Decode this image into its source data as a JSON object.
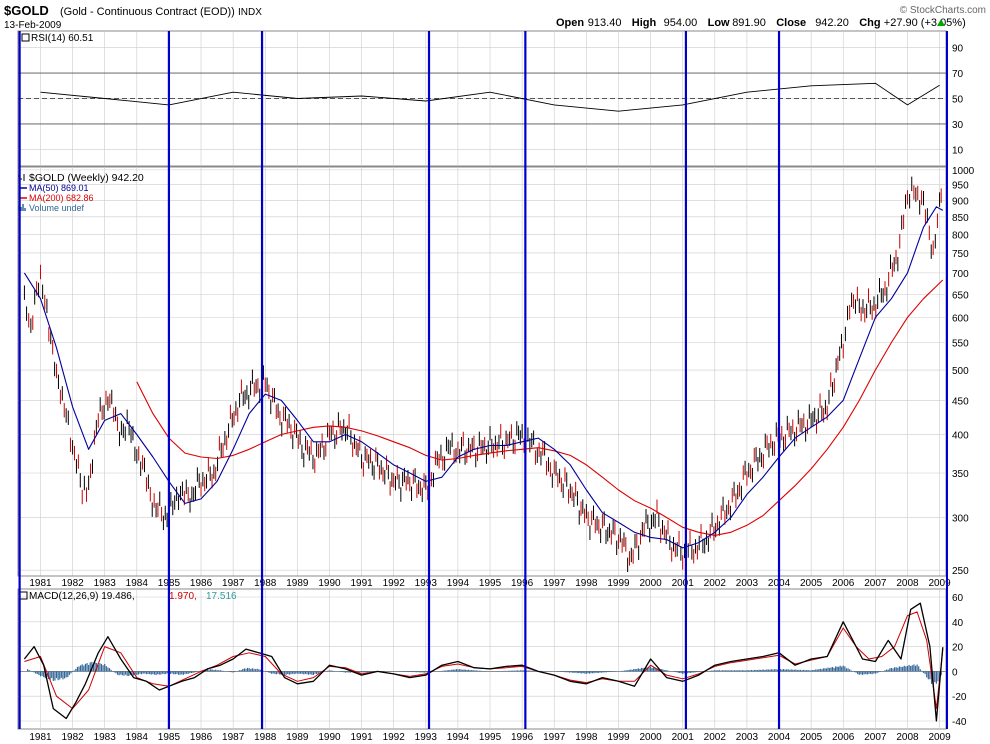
{
  "header": {
    "symbol": "$GOLD",
    "description": "(Gold - Continuous Contract (EOD))",
    "exchange": "INDX",
    "date": "13-Feb-2009",
    "watermark": "© StockCharts.com",
    "ohlc": [
      {
        "label": "Open",
        "value": "913.40"
      },
      {
        "label": "High",
        "value": "954.00"
      },
      {
        "label": "Low",
        "value": "891.90"
      },
      {
        "label": "Close",
        "value": "942.20"
      },
      {
        "label": "Chg",
        "value": "+27.90 (+3.05%)"
      }
    ],
    "chg_arrow": "up-arrow-icon"
  },
  "colors": {
    "price": "#000000",
    "price_down": "#cc0000",
    "ma50": "#000099",
    "ma200": "#dd0000",
    "volume": "#336699",
    "vlines": "#0000cc",
    "grid": "#cccccc",
    "macd": "#000000",
    "signal": "#cc0000",
    "histogram": "#336699",
    "teal": "#339999"
  },
  "chart_data": [
    {
      "type": "line",
      "panel": "RSI",
      "legend": "RSI(14) 60.51",
      "ylim": [
        0,
        100
      ],
      "yticks": [
        "90",
        "70",
        "50",
        "30",
        "10"
      ],
      "reference_lines": [
        30,
        50,
        70
      ],
      "x": [
        "1981",
        "1983",
        "1985",
        "1987",
        "1989",
        "1991",
        "1993",
        "1995",
        "1997",
        "1999",
        "2001",
        "2003",
        "2005",
        "2007",
        "2008",
        "2009"
      ],
      "y": [
        55,
        50,
        45,
        55,
        50,
        52,
        48,
        55,
        45,
        40,
        45,
        55,
        60,
        62,
        45,
        60.51
      ]
    },
    {
      "type": "line",
      "panel": "Price",
      "scale": "log",
      "ylim": [
        250,
        1000
      ],
      "yticks": [
        "1000",
        "950",
        "900",
        "850",
        "800",
        "750",
        "700",
        "650",
        "600",
        "550",
        "500",
        "450",
        "400",
        "350",
        "300",
        "250"
      ],
      "legend": [
        {
          "text": "$GOLD (Weekly) 942.20",
          "color": "#000000",
          "kind": "bar"
        },
        {
          "text": "MA(50) 869.01",
          "color": "#000099",
          "kind": "line"
        },
        {
          "text": "MA(200) 682.86",
          "color": "#dd0000",
          "kind": "line"
        },
        {
          "text": "Volume undef",
          "color": "#336699",
          "kind": "volume"
        }
      ],
      "xticks": [
        "1981",
        "1982",
        "1983",
        "1984",
        "1985",
        "1986",
        "1987",
        "1988",
        "1989",
        "1990",
        "1991",
        "1992",
        "1993",
        "1994",
        "1995",
        "1996",
        "1997",
        "1998",
        "1999",
        "2000",
        "2001",
        "2002",
        "2003",
        "2004",
        "2005",
        "2006",
        "2007",
        "2008",
        "2009"
      ],
      "series": [
        {
          "name": "$GOLD (Weekly)",
          "x": [
            1980.5,
            1980.7,
            1981.0,
            1981.2,
            1981.5,
            1981.8,
            1982.0,
            1982.3,
            1982.5,
            1982.8,
            1983.1,
            1983.4,
            1983.7,
            1984.0,
            1984.3,
            1984.6,
            1985.0,
            1985.3,
            1985.6,
            1986.0,
            1986.4,
            1986.8,
            1987.2,
            1987.6,
            1988.0,
            1988.4,
            1988.8,
            1989.2,
            1989.6,
            1990.0,
            1990.5,
            1991.0,
            1991.5,
            1992.0,
            1992.5,
            1993.0,
            1993.3,
            1993.7,
            1994.0,
            1994.5,
            1995.0,
            1995.5,
            1996.0,
            1996.3,
            1996.7,
            1997.0,
            1997.5,
            1998.0,
            1998.5,
            1999.0,
            1999.4,
            1999.8,
            2000.2,
            2000.6,
            2001.0,
            2001.4,
            2001.8,
            2002.2,
            2002.6,
            2003.0,
            2003.4,
            2003.8,
            2004.2,
            2004.6,
            2005.0,
            2005.5,
            2006.0,
            2006.2,
            2006.5,
            2006.9,
            2007.3,
            2007.7,
            2008.0,
            2008.2,
            2008.5,
            2008.8,
            2009.0,
            2009.1
          ],
          "y": [
            650,
            580,
            690,
            620,
            480,
            440,
            380,
            330,
            340,
            420,
            460,
            410,
            410,
            380,
            340,
            310,
            300,
            330,
            320,
            340,
            350,
            400,
            450,
            470,
            480,
            430,
            410,
            380,
            370,
            400,
            410,
            370,
            360,
            340,
            340,
            330,
            360,
            380,
            380,
            380,
            385,
            390,
            400,
            385,
            370,
            350,
            330,
            300,
            290,
            280,
            260,
            290,
            300,
            275,
            265,
            270,
            280,
            300,
            320,
            350,
            370,
            390,
            400,
            410,
            420,
            440,
            550,
            640,
            620,
            620,
            660,
            750,
            900,
            950,
            880,
            760,
            900,
            942
          ]
        },
        {
          "name": "MA(50)",
          "x": [
            1980.5,
            1981.0,
            1981.5,
            1982.0,
            1982.5,
            1983.0,
            1983.5,
            1984.0,
            1984.5,
            1985.0,
            1985.5,
            1986.0,
            1986.5,
            1987.0,
            1987.5,
            1988.0,
            1988.5,
            1989.0,
            1989.5,
            1990.0,
            1990.5,
            1991.0,
            1991.5,
            1992.0,
            1992.5,
            1993.0,
            1993.5,
            1994.0,
            1994.5,
            1995.0,
            1995.5,
            1996.0,
            1996.5,
            1997.0,
            1997.5,
            1998.0,
            1998.5,
            1999.0,
            1999.5,
            2000.0,
            2000.5,
            2001.0,
            2001.5,
            2002.0,
            2002.5,
            2003.0,
            2003.5,
            2004.0,
            2004.5,
            2005.0,
            2005.5,
            2006.0,
            2006.5,
            2007.0,
            2007.5,
            2008.0,
            2008.5,
            2008.9,
            2009.1
          ],
          "y": [
            700,
            640,
            540,
            440,
            380,
            420,
            430,
            400,
            370,
            340,
            315,
            320,
            340,
            380,
            430,
            460,
            450,
            420,
            390,
            390,
            400,
            390,
            375,
            360,
            350,
            340,
            345,
            370,
            380,
            385,
            385,
            390,
            395,
            380,
            360,
            330,
            305,
            295,
            285,
            280,
            278,
            270,
            275,
            285,
            300,
            325,
            345,
            370,
            395,
            410,
            425,
            450,
            520,
            600,
            640,
            700,
            820,
            880,
            869
          ]
        },
        {
          "name": "MA(200)",
          "x": [
            1984.0,
            1984.5,
            1985.0,
            1985.5,
            1986.0,
            1986.5,
            1987.0,
            1987.5,
            1988.0,
            1988.5,
            1989.0,
            1989.5,
            1990.0,
            1990.5,
            1991.0,
            1991.5,
            1992.0,
            1992.5,
            1993.0,
            1993.5,
            1994.0,
            1994.5,
            1995.0,
            1995.5,
            1996.0,
            1996.5,
            1997.0,
            1997.5,
            1998.0,
            1998.5,
            1999.0,
            1999.5,
            2000.0,
            2000.5,
            2001.0,
            2001.5,
            2002.0,
            2002.5,
            2003.0,
            2003.5,
            2004.0,
            2004.5,
            2005.0,
            2005.5,
            2006.0,
            2006.5,
            2007.0,
            2007.5,
            2008.0,
            2008.5,
            2009.1
          ],
          "y": [
            480,
            430,
            395,
            375,
            370,
            368,
            372,
            380,
            390,
            400,
            405,
            410,
            412,
            410,
            405,
            398,
            390,
            382,
            372,
            366,
            368,
            372,
            375,
            378,
            380,
            382,
            378,
            372,
            360,
            345,
            330,
            318,
            310,
            300,
            290,
            285,
            282,
            285,
            292,
            302,
            318,
            335,
            355,
            380,
            410,
            450,
            500,
            550,
            600,
            640,
            683
          ]
        }
      ]
    },
    {
      "type": "line",
      "panel": "MACD",
      "legend": {
        "label": "MACD(12,26,9)",
        "v1": "19.486",
        "v2": "1.970",
        "v3": "17.516"
      },
      "ylim": [
        -40,
        60
      ],
      "yticks": [
        "60",
        "40",
        "20",
        "0",
        "-20",
        "-40"
      ],
      "xticks": [
        "1981",
        "1982",
        "1983",
        "1984",
        "1985",
        "1986",
        "1987",
        "1988",
        "1989",
        "1990",
        "1991",
        "1992",
        "1993",
        "1994",
        "1995",
        "1996",
        "1997",
        "1998",
        "1999",
        "2000",
        "2001",
        "2002",
        "2003",
        "2004",
        "2005",
        "2006",
        "2007",
        "2008",
        "2009"
      ],
      "series": [
        {
          "name": "MACD",
          "x": [
            1980.5,
            1980.8,
            1981.1,
            1981.4,
            1981.8,
            1982.1,
            1982.4,
            1982.8,
            1983.1,
            1983.5,
            1983.9,
            1984.3,
            1984.7,
            1985.0,
            1985.4,
            1985.8,
            1986.2,
            1986.6,
            1987.0,
            1987.4,
            1987.8,
            1988.2,
            1988.6,
            1989.0,
            1989.5,
            1990.0,
            1990.5,
            1991.0,
            1991.5,
            1992.0,
            1992.5,
            1993.0,
            1993.5,
            1994.0,
            1994.5,
            1995.0,
            1995.5,
            1996.0,
            1996.5,
            1997.0,
            1997.5,
            1998.0,
            1998.5,
            1999.0,
            1999.5,
            2000.0,
            2000.5,
            2001.0,
            2001.5,
            2002.0,
            2002.5,
            2003.0,
            2003.5,
            2004.0,
            2004.5,
            2005.0,
            2005.5,
            2006.0,
            2006.3,
            2006.6,
            2007.0,
            2007.4,
            2007.8,
            2008.1,
            2008.4,
            2008.7,
            2008.9,
            2009.1
          ],
          "y": [
            10,
            20,
            5,
            -30,
            -38,
            -25,
            -10,
            15,
            28,
            10,
            -5,
            -8,
            -15,
            -12,
            -8,
            -5,
            2,
            5,
            10,
            18,
            15,
            12,
            -5,
            -10,
            -8,
            5,
            2,
            -3,
            0,
            -2,
            -5,
            -3,
            5,
            8,
            3,
            2,
            4,
            5,
            0,
            -3,
            -8,
            -10,
            -5,
            -8,
            -12,
            10,
            -5,
            -8,
            -3,
            5,
            8,
            10,
            12,
            15,
            5,
            10,
            12,
            40,
            25,
            10,
            8,
            25,
            10,
            50,
            55,
            20,
            -40,
            19.486
          ]
        },
        {
          "name": "Signal",
          "x": [
            1980.5,
            1981.0,
            1981.5,
            1982.0,
            1982.5,
            1983.0,
            1983.5,
            1984.0,
            1984.5,
            1985.0,
            1985.5,
            1986.0,
            1986.5,
            1987.0,
            1987.5,
            1988.0,
            1988.5,
            1989.0,
            1989.5,
            1990.0,
            1990.5,
            1991.0,
            1991.5,
            1992.0,
            1992.5,
            1993.0,
            1993.5,
            1994.0,
            1994.5,
            1995.0,
            1995.5,
            1996.0,
            1996.5,
            1997.0,
            1997.5,
            1998.0,
            1998.5,
            1999.0,
            1999.5,
            2000.0,
            2000.5,
            2001.0,
            2001.5,
            2002.0,
            2002.5,
            2003.0,
            2003.5,
            2004.0,
            2004.5,
            2005.0,
            2005.5,
            2006.0,
            2006.4,
            2006.8,
            2007.2,
            2007.6,
            2008.0,
            2008.3,
            2008.6,
            2008.9,
            2009.1
          ],
          "y": [
            8,
            12,
            -20,
            -30,
            -15,
            20,
            15,
            -5,
            -10,
            -12,
            -6,
            0,
            5,
            12,
            15,
            12,
            -2,
            -8,
            -5,
            4,
            3,
            -2,
            0,
            -2,
            -4,
            -2,
            4,
            6,
            3,
            2,
            3,
            4,
            0,
            -3,
            -7,
            -9,
            -6,
            -8,
            -8,
            5,
            -3,
            -6,
            -2,
            4,
            7,
            9,
            11,
            13,
            6,
            9,
            12,
            35,
            20,
            10,
            12,
            20,
            45,
            48,
            25,
            -30,
            17.516
          ]
        }
      ],
      "histogram": {
        "name": "Histogram",
        "x": [
          1980.6,
          1981.0,
          1981.4,
          1981.8,
          1982.2,
          1982.6,
          1983.0,
          1983.4,
          1983.8,
          1984.2,
          1984.6,
          1985.0,
          1985.4,
          1985.8,
          1986.2,
          1986.6,
          1987.0,
          1987.4,
          1987.8,
          1988.2,
          1988.6,
          1989.0,
          1989.5,
          1990.0,
          1990.5,
          1991.0,
          1992.0,
          1993.0,
          1994.0,
          1995.0,
          1996.0,
          1997.0,
          1998.0,
          1999.0,
          2000.0,
          2001.0,
          2002.0,
          2003.0,
          2004.0,
          2005.0,
          2006.0,
          2006.5,
          2007.0,
          2007.5,
          2008.0,
          2008.3,
          2008.6,
          2008.8,
          2009.0,
          2009.1
        ],
        "y": [
          2,
          -4,
          -8,
          -6,
          5,
          8,
          6,
          -3,
          -4,
          -2,
          -3,
          -2,
          -3,
          -1,
          2,
          1,
          -1,
          3,
          2,
          -2,
          -3,
          -2,
          -3,
          1,
          -1,
          -1,
          0,
          -1,
          2,
          0,
          1,
          0,
          -2,
          0,
          4,
          -2,
          1,
          1,
          2,
          1,
          5,
          -3,
          -2,
          3,
          5,
          6,
          -5,
          -12,
          -8,
          2
        ]
      }
    }
  ]
}
